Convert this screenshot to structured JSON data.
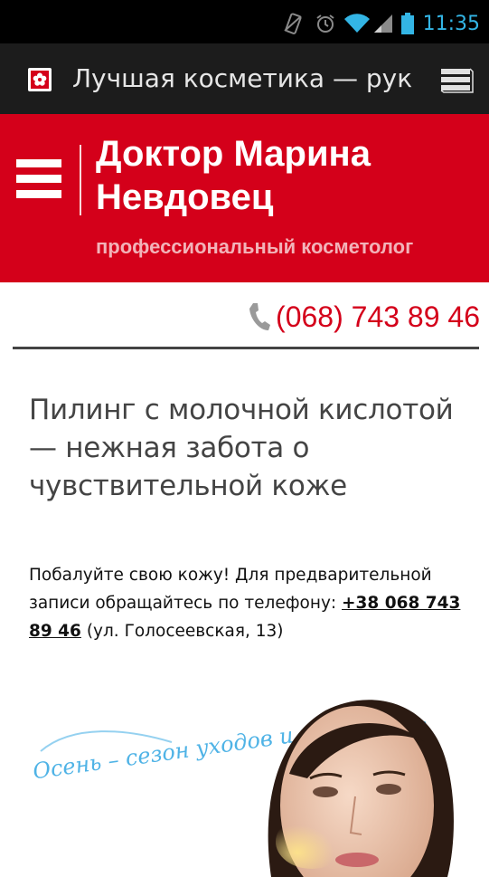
{
  "status_bar": {
    "time": "11:35",
    "icons": [
      "vibrate-icon",
      "alarm-icon",
      "wifi-icon",
      "signal-icon",
      "battery-icon"
    ],
    "time_color": "#33b5e5"
  },
  "browser": {
    "page_title": "Лучшая косметика — рук",
    "favicon": "flower-favicon-icon",
    "menu_icon": "stacked-pages-icon"
  },
  "header": {
    "brand_name": "Доктор Марина Невдовец",
    "subtitle": "профессиональный косметолог",
    "menu_icon": "hamburger-icon",
    "background_color": "#d4001a"
  },
  "contact": {
    "phone": "(068) 743 89 46",
    "phone_icon": "phone-handset-icon"
  },
  "article": {
    "title": "Пилинг с молочной кислотой — нежная забота о чувствительной коже",
    "text_before": "Побалуйте свою кожу! Для предварительной записи обращайтесь по телефону: ",
    "phone_link": "+38 068 743 89 46",
    "text_after": " (ул. Голосеевская, 13)"
  },
  "promo": {
    "slogan": "Осень – сезон уходов и пилингов…",
    "image": "woman-face-photo"
  }
}
